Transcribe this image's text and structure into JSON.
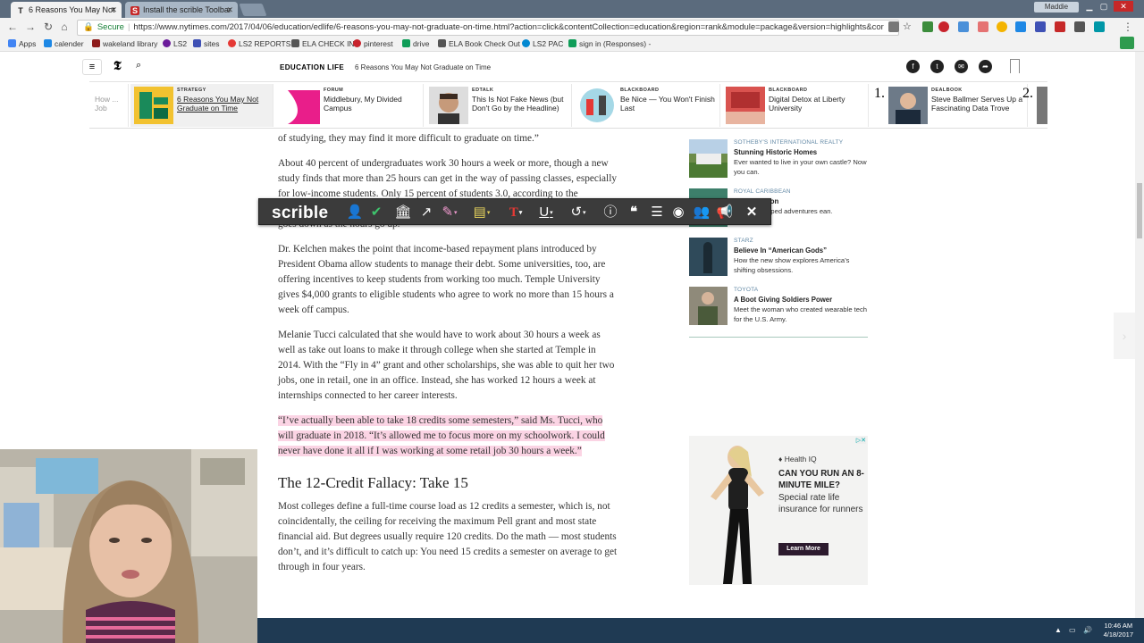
{
  "browser": {
    "tabs": [
      {
        "label": "6 Reasons You May Not",
        "favicon": "T",
        "active": true
      },
      {
        "label": "Install the scrible Toolbar",
        "favicon": "S",
        "active": false
      }
    ],
    "user": "Maddie",
    "secure_label": "Secure",
    "url": "https://www.nytimes.com/2017/04/06/education/edlife/6-reasons-you-may-not-graduate-on-time.html?action=click&contentCollection=education&region=rank&module=package&version=highlights&cor",
    "bookmarks": [
      "Apps",
      "calender",
      "wakeland library",
      "LS2",
      "sites",
      "LS2 REPORTS",
      "ELA CHECK IN",
      "pinterest",
      "drive",
      "ELA Book Check Out",
      "LS2 PAC",
      "sign in (Responses) -"
    ]
  },
  "nyt": {
    "section": "EDUCATION LIFE",
    "headline": "6 Reasons You May Not Graduate on Time",
    "ribbon": [
      {
        "kicker": "",
        "title": "How ... Job"
      },
      {
        "kicker": "STRATEGY",
        "title": "6 Reasons You May Not Graduate on Time",
        "selected": true
      },
      {
        "kicker": "FORUM",
        "title": "Middlebury, My Divided Campus"
      },
      {
        "kicker": "EDTALK",
        "title": "This Is Not Fake News (but Don't Go by the Headline)"
      },
      {
        "kicker": "BLACKBOARD",
        "title": "Be Nice — You Won't Finish Last"
      },
      {
        "kicker": "BLACKBOARD",
        "title": "Digital Detox at Liberty University"
      },
      {
        "kicker": "DEALBOOK",
        "title": "Steve Ballmer Serves Up a Fascinating Data Trove"
      }
    ],
    "ribbon_numbers": [
      "1.",
      "2."
    ],
    "article": {
      "p1": "of studying, they may find it more difficult to graduate on time.”",
      "p2": "About 40 percent of undergraduates work 30 hours a week or more, though a new study finds that more than 25 hours can get in the way of passing classes, especially for low-income students. Only 15 percent of students 3.0, according to the Georgetown University Center on Education and the Workforce. The percentage goes down as the hours go up.",
      "p3": "Dr. Kelchen makes the point that income-based repayment plans introduced by President Obama allow students to manage their debt. Some universities, too, are offering incentives to keep students from working too much. Temple University gives $4,000 grants to eligible students who agree to work no more than 15 hours a week off campus.",
      "p4": "Melanie Tucci calculated that she would have to work about 30 hours a week as well as take out loans to make it through college when she started at Temple in 2014. With the “Fly in 4” grant and other scholarships, she was able to quit her two jobs, one in retail, one in an office. Instead, she has worked 12 hours a week at internships connected to her career interests.",
      "p5_highlighted": "“I’ve actually been able to take 18 credits some semesters,” said Ms. Tucci, who will graduate in 2018. “It’s allowed me to focus more on my schoolwork. I could never have done it all if I was working at some retail job 30 hours a week.”",
      "h2": "The 12-Credit Fallacy: Take 15",
      "p6": "Most colleges define a full-time course load as 12 credits a semester, which is, not coincidentally, the ceiling for receiving the maximum Pell grant and most state financial aid. But degrees usually require 120 credits. Do the math — most students don’t, and it’s difficult to catch up: You need 15 credits a semester on average to get through in four years."
    },
    "sidebar": [
      {
        "kicker": "SOTHEBY'S INTERNATIONAL REALTY",
        "title": "Stunning Historic Homes",
        "desc": "Ever wanted to live in your own castle? Now you can."
      },
      {
        "kicker": "ROYAL CARIBBEAN",
        "title": "cted Vacation",
        "desc": "all the untapped adventures ean."
      },
      {
        "kicker": "STARZ",
        "title": "Believe In “American Gods”",
        "desc": "How the new show explores America’s shifting obsessions."
      },
      {
        "kicker": "TOYOTA",
        "title": "A Boot Giving Soldiers Power",
        "desc": "Meet the woman who created wearable tech for the U.S. Army."
      }
    ],
    "ad": {
      "brand": "Health IQ",
      "head": "CAN YOU RUN AN 8-MINUTE MILE?",
      "sub": "Special rate life insurance for runners",
      "cta": "Learn More"
    }
  },
  "scrible": {
    "logo": "scrible"
  },
  "taskbar": {
    "time": "10:46 AM",
    "date": "4/18/2017"
  },
  "colors": {
    "highlight": "#fbd4e4",
    "scrible_bg": "#3b3b3b",
    "taskbar": "#1f3a53"
  }
}
